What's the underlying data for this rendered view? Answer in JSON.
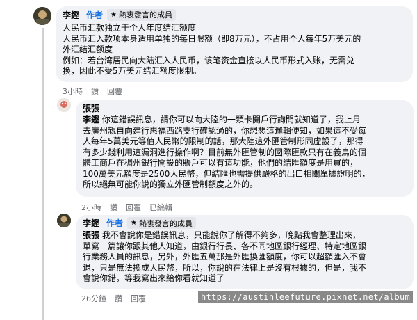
{
  "comment1": {
    "name": "李鏗",
    "role": "作者",
    "badge": "熱衷發言的成員",
    "lines": [
      "人民币汇款独立于个人年度结汇额度",
      "人民币汇入款项本身适用单独的每日限额（即8万元），不占用个人每年5万美元的",
      "外汇结汇额度",
      "例如：若台湾居民向大陆汇入人民币，该笔资金直接以人民币形式入账，无需兑",
      "换，因此不受5万美元结汇额度限制。"
    ],
    "time": "3小時",
    "like": "讚",
    "reply": "回覆"
  },
  "comment2": {
    "name": "張張",
    "mention": "李鏗",
    "lines": [
      "你這錯誤訊息，請你可以向大陸的一類卡開戶行詢問就知道了，我上月",
      "去廣州親自向建行惠福西路支行確認過的，你想想這邏輯便知，如果這不受每",
      "人每年5萬美元等值人民幣的限制的話，那大陸這外匯管制形同虛設了，那得",
      "有多少錢利用這漏洞進行操作啊？目前無外匯管制的國際匯款只有在義烏的個",
      "體工商戶在稠州銀行開設的賬戶可以有這功能，他們的結匯額度是用買的，",
      "100萬美元額度是2500人民幣，但結匯也需提供嚴格的出口相關單據證明的，",
      "所以絕無可能你說的獨立外匯管制額度之外的。"
    ],
    "time": "2小時",
    "like": "讚",
    "reply": "回覆",
    "edited": "已編輯"
  },
  "comment3": {
    "name": "李鏗",
    "role": "作者",
    "badge": "熱衷發言的成員",
    "mention": "張張",
    "lines": [
      "我不會說你是錯誤訊息，只能說你了解得不夠多，晚點我會整理出來，",
      "單寫一篇讓你跟其他人知道，由銀行行長、各不同地區銀行經理、特定地區銀",
      "行業務人員的訊息，另外，外匯五萬那是外匯換匯額度，你可以超額匯入不會",
      "退，只是無法換成人民幣，所以，你說的在法律上是沒有根據的，但是，我不",
      "會說你錯，等我寫出來給你看就知道了"
    ],
    "time": "26分鐘",
    "like": "讚",
    "reply": "回覆"
  },
  "watermark": "https://austinleefuture.pixnet.net/album"
}
